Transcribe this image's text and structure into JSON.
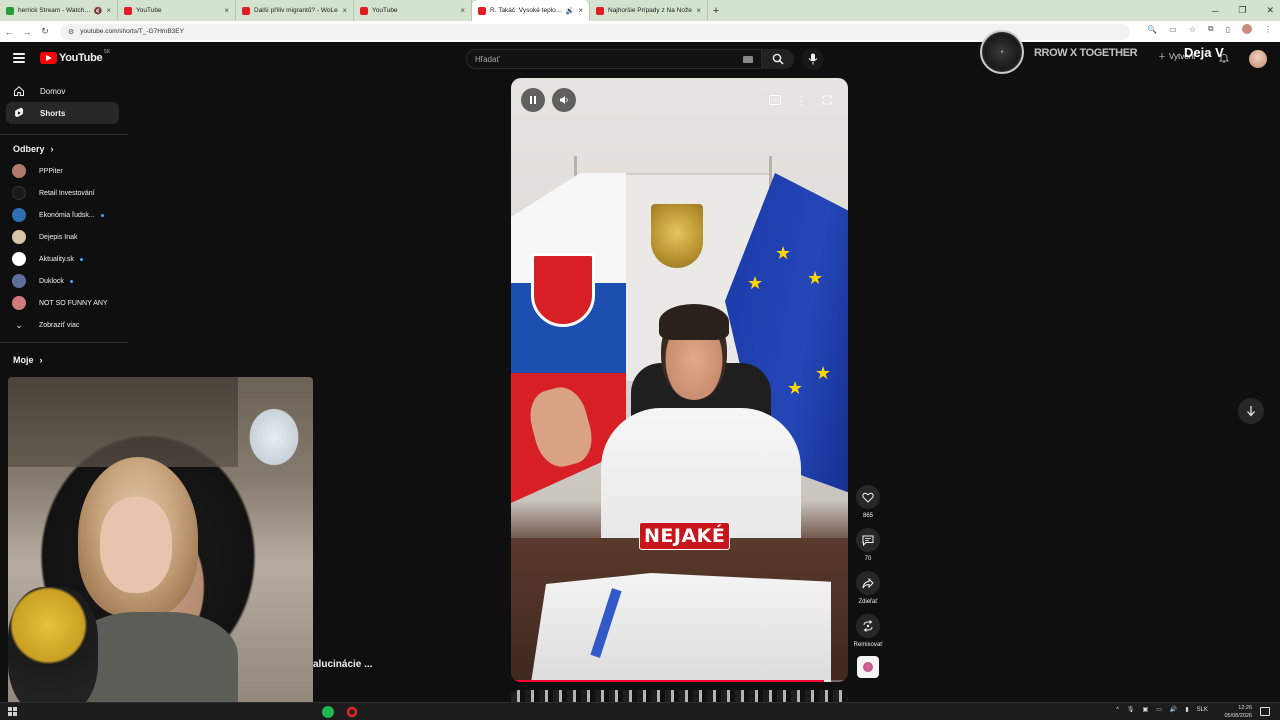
{
  "browser": {
    "tabs": [
      {
        "title": "herrick Stream - Watch Live",
        "favicon": "twitch",
        "muted": true
      },
      {
        "title": "YouTube",
        "favicon": "yt"
      },
      {
        "title": "Další příliv migrantů? - WoLe",
        "favicon": "yt"
      },
      {
        "title": "YouTube",
        "favicon": "yt"
      },
      {
        "title": "R. Takáč: Vysoké teploty, v...",
        "favicon": "yt",
        "active": true,
        "audio": true
      },
      {
        "title": "Najhoršie Prípady z Na Nože",
        "favicon": "yt"
      }
    ],
    "url": "youtube.com/shorts/T_-G7HmB3EY"
  },
  "header": {
    "logo_text": "YouTube",
    "country": "SK",
    "search_placeholder": "Hľadať",
    "overlay_text": "RROW X TOGETHER",
    "create_label": "Vytvoriť",
    "stream_overlay": "Deja V"
  },
  "sidebar": {
    "main": [
      {
        "label": "Domov",
        "icon": "home-icon"
      },
      {
        "label": "Shorts",
        "icon": "shorts-icon",
        "selected": true
      }
    ],
    "subscriptions_title": "Odbery",
    "subscriptions": [
      {
        "label": "PPPiter",
        "color": "#b07a6a",
        "dot": false
      },
      {
        "label": "Retail Investování",
        "color": "#1a1a1a",
        "dot": false
      },
      {
        "label": "Ekonómia ľudsk...",
        "color": "#2f6fb0",
        "dot": true
      },
      {
        "label": "Dejepis Inak",
        "color": "#d8c4a8",
        "dot": false
      },
      {
        "label": "Aktuality.sk",
        "color": "#ffffff",
        "dot": true
      },
      {
        "label": "Duklock",
        "color": "#5f6f9a",
        "dot": true
      },
      {
        "label": "NOT SO FUNNY ANY",
        "color": "#d07a7a",
        "dot": false
      }
    ],
    "show_more": "Zobraziť viac",
    "my_title": "Moje"
  },
  "player": {
    "caption": "NEJAKÉ",
    "progress": 0.93
  },
  "actions": {
    "likes": "865",
    "comments": "70",
    "share": "Zdieľať",
    "remix": "Remixovať"
  },
  "caption_fragment": "alucinácie ...",
  "taskbar": {
    "lang": "SLK",
    "time": "12:26",
    "date": "05/08/2026"
  }
}
